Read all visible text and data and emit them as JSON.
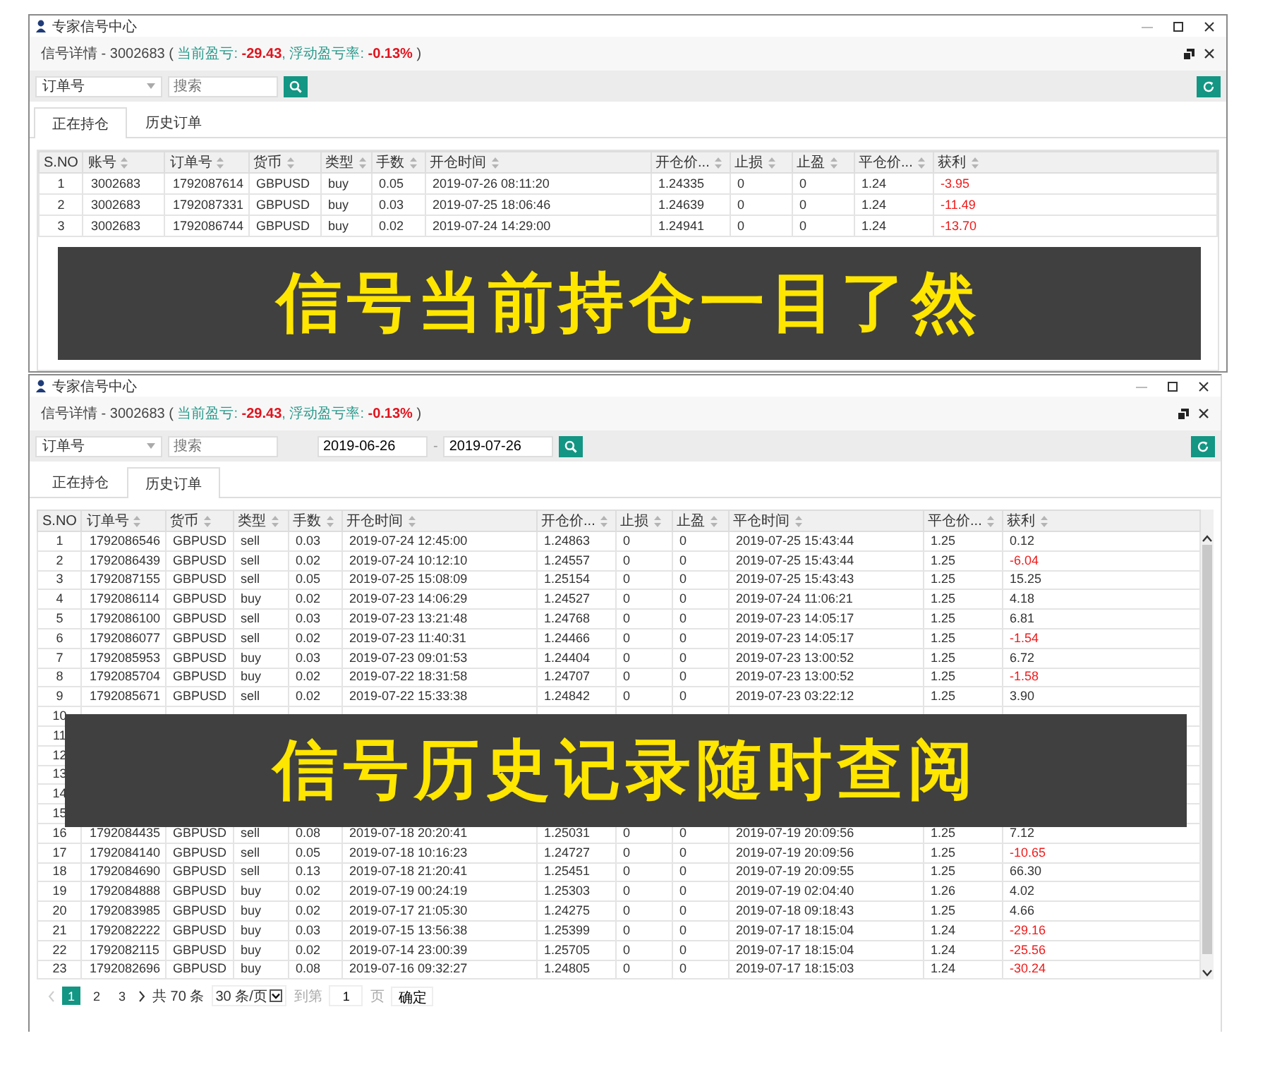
{
  "windows": [
    {
      "title": "专家信号中心",
      "summary": [
        {
          "text": "信号详情 - 3002683 ( ",
          "kind": "plain"
        },
        {
          "text": "当前盈亏: ",
          "kind": "label"
        },
        {
          "text": "-29.43",
          "kind": "value"
        },
        {
          "text": ", 浮动盈亏率: ",
          "kind": "label"
        },
        {
          "text": "-0.13%",
          "kind": "value"
        },
        {
          "text": " )",
          "kind": "plain"
        }
      ],
      "toolbar": {
        "select": "订单号",
        "search_placeholder": "搜索"
      },
      "tabs": [
        {
          "label": "正在持仓",
          "selected": true
        },
        {
          "label": "历史订单",
          "selected": false
        }
      ],
      "columns": [
        "S.NO",
        "账号",
        "订单号",
        "货币",
        "类型",
        "手数",
        "开仓时间",
        "开仓价...",
        "止损",
        "止盈",
        "平仓价...",
        "获利"
      ],
      "rows": [
        {
          "cells": [
            "1",
            "3002683",
            "1792087614",
            "GBPUSD",
            "buy",
            "0.05",
            "2019-07-26 08:11:20",
            "1.24335",
            "0",
            "0",
            "1.24",
            "-3.95"
          ],
          "loss": true
        },
        {
          "cells": [
            "2",
            "3002683",
            "1792087331",
            "GBPUSD",
            "buy",
            "0.03",
            "2019-07-25 18:06:46",
            "1.24639",
            "0",
            "0",
            "1.24",
            "-11.49"
          ],
          "loss": true
        },
        {
          "cells": [
            "3",
            "3002683",
            "1792086744",
            "GBPUSD",
            "buy",
            "0.02",
            "2019-07-24 14:29:00",
            "1.24941",
            "0",
            "0",
            "1.24",
            "-13.70"
          ],
          "loss": true
        }
      ],
      "banner": "信号当前持仓一目了然"
    },
    {
      "title": "专家信号中心",
      "summary": [
        {
          "text": "信号详情 - 3002683 ( ",
          "kind": "plain"
        },
        {
          "text": "当前盈亏: ",
          "kind": "label"
        },
        {
          "text": "-29.43",
          "kind": "value"
        },
        {
          "text": ", 浮动盈亏率: ",
          "kind": "label"
        },
        {
          "text": "-0.13%",
          "kind": "value"
        },
        {
          "text": " )",
          "kind": "plain"
        }
      ],
      "toolbar": {
        "select": "订单号",
        "search_placeholder": "搜索",
        "date_from": "2019-06-26",
        "date_separator": "-",
        "date_to": "2019-07-26"
      },
      "tabs": [
        {
          "label": "正在持仓",
          "selected": false
        },
        {
          "label": "历史订单",
          "selected": true
        }
      ],
      "columns": [
        "S.NO",
        "订单号",
        "货币",
        "类型",
        "手数",
        "开仓时间",
        "开仓价...",
        "止损",
        "止盈",
        "平仓时间",
        "平仓价...",
        "获利"
      ],
      "rows": [
        {
          "cells": [
            "1",
            "1792086546",
            "GBPUSD",
            "sell",
            "0.03",
            "2019-07-24 12:45:00",
            "1.24863",
            "0",
            "0",
            "2019-07-25 15:43:44",
            "1.25",
            "0.12"
          ],
          "loss": false
        },
        {
          "cells": [
            "2",
            "1792086439",
            "GBPUSD",
            "sell",
            "0.02",
            "2019-07-24 10:12:10",
            "1.24557",
            "0",
            "0",
            "2019-07-25 15:43:44",
            "1.25",
            "-6.04"
          ],
          "loss": true
        },
        {
          "cells": [
            "3",
            "1792087155",
            "GBPUSD",
            "sell",
            "0.05",
            "2019-07-25 15:08:09",
            "1.25154",
            "0",
            "0",
            "2019-07-25 15:43:43",
            "1.25",
            "15.25"
          ],
          "loss": false
        },
        {
          "cells": [
            "4",
            "1792086114",
            "GBPUSD",
            "buy",
            "0.02",
            "2019-07-23 14:06:29",
            "1.24527",
            "0",
            "0",
            "2019-07-24 11:06:21",
            "1.25",
            "4.18"
          ],
          "loss": false
        },
        {
          "cells": [
            "5",
            "1792086100",
            "GBPUSD",
            "sell",
            "0.03",
            "2019-07-23 13:21:48",
            "1.24768",
            "0",
            "0",
            "2019-07-23 14:05:17",
            "1.25",
            "6.81"
          ],
          "loss": false
        },
        {
          "cells": [
            "6",
            "1792086077",
            "GBPUSD",
            "sell",
            "0.02",
            "2019-07-23 11:40:31",
            "1.24466",
            "0",
            "0",
            "2019-07-23 14:05:17",
            "1.25",
            "-1.54"
          ],
          "loss": true
        },
        {
          "cells": [
            "7",
            "1792085953",
            "GBPUSD",
            "buy",
            "0.03",
            "2019-07-23 09:01:53",
            "1.24404",
            "0",
            "0",
            "2019-07-23 13:00:52",
            "1.25",
            "6.72"
          ],
          "loss": false
        },
        {
          "cells": [
            "8",
            "1792085704",
            "GBPUSD",
            "buy",
            "0.02",
            "2019-07-22 18:31:58",
            "1.24707",
            "0",
            "0",
            "2019-07-23 13:00:52",
            "1.25",
            "-1.58"
          ],
          "loss": true
        },
        {
          "cells": [
            "9",
            "1792085671",
            "GBPUSD",
            "sell",
            "0.02",
            "2019-07-22 15:33:38",
            "1.24842",
            "0",
            "0",
            "2019-07-23 03:22:12",
            "1.25",
            "3.90"
          ],
          "loss": false
        },
        {
          "cells": [
            "10"
          ]
        },
        {
          "cells": [
            "11"
          ]
        },
        {
          "cells": [
            "12"
          ]
        },
        {
          "cells": [
            "13"
          ]
        },
        {
          "cells": [
            "14"
          ]
        },
        {
          "cells": [
            "15"
          ]
        },
        {
          "cells": [
            "16",
            "1792084435",
            "GBPUSD",
            "sell",
            "0.08",
            "2019-07-18 20:20:41",
            "1.25031",
            "0",
            "0",
            "2019-07-19 20:09:56",
            "1.25",
            "7.12"
          ],
          "loss": false
        },
        {
          "cells": [
            "17",
            "1792084140",
            "GBPUSD",
            "sell",
            "0.05",
            "2019-07-18 10:16:23",
            "1.24727",
            "0",
            "0",
            "2019-07-19 20:09:56",
            "1.25",
            "-10.65"
          ],
          "loss": true
        },
        {
          "cells": [
            "18",
            "1792084690",
            "GBPUSD",
            "sell",
            "0.13",
            "2019-07-18 21:20:41",
            "1.25451",
            "0",
            "0",
            "2019-07-19 20:09:55",
            "1.25",
            "66.30"
          ],
          "loss": false
        },
        {
          "cells": [
            "19",
            "1792084888",
            "GBPUSD",
            "buy",
            "0.02",
            "2019-07-19 00:24:19",
            "1.25303",
            "0",
            "0",
            "2019-07-19 02:04:40",
            "1.26",
            "4.02"
          ],
          "loss": false
        },
        {
          "cells": [
            "20",
            "1792083985",
            "GBPUSD",
            "buy",
            "0.02",
            "2019-07-17 21:05:30",
            "1.24275",
            "0",
            "0",
            "2019-07-18 09:18:43",
            "1.25",
            "4.66"
          ],
          "loss": false
        },
        {
          "cells": [
            "21",
            "1792082222",
            "GBPUSD",
            "buy",
            "0.03",
            "2019-07-15 13:56:38",
            "1.25399",
            "0",
            "0",
            "2019-07-17 18:15:04",
            "1.24",
            "-29.16"
          ],
          "loss": true
        },
        {
          "cells": [
            "22",
            "1792082115",
            "GBPUSD",
            "buy",
            "0.02",
            "2019-07-14 23:00:39",
            "1.25705",
            "0",
            "0",
            "2019-07-17 18:15:04",
            "1.24",
            "-25.56"
          ],
          "loss": true
        },
        {
          "cells": [
            "23",
            "1792082696",
            "GBPUSD",
            "buy",
            "0.08",
            "2019-07-16 09:32:27",
            "1.24805",
            "0",
            "0",
            "2019-07-17 18:15:03",
            "1.24",
            "-30.24"
          ],
          "loss": true
        }
      ],
      "pagination": {
        "pages": [
          {
            "label": "1",
            "selected": true
          },
          {
            "label": "2",
            "selected": false
          },
          {
            "label": "3",
            "selected": false
          }
        ],
        "total": "共 70 条",
        "page_size": "30 条/页",
        "goto_label": "到第",
        "goto_value": "1",
        "page_label": "页",
        "confirm": "确定"
      },
      "banner": "信号历史记录随时查阅"
    }
  ]
}
